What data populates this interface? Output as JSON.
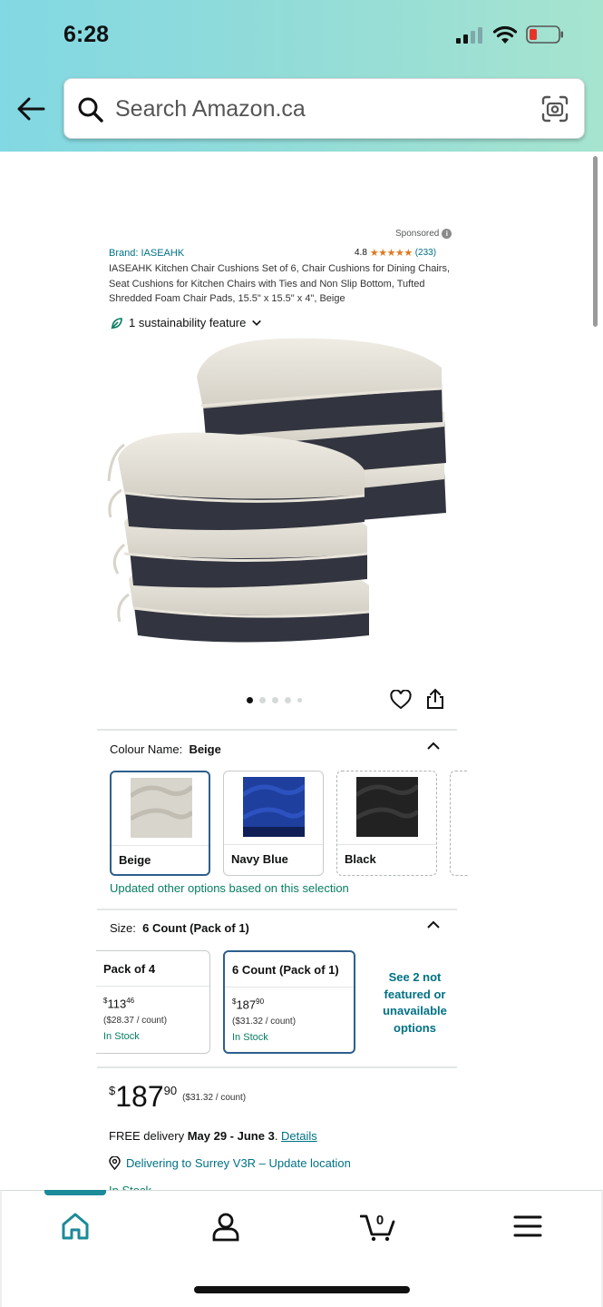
{
  "status_bar": {
    "time": "6:28"
  },
  "search": {
    "placeholder": "Search Amazon.ca"
  },
  "product": {
    "sponsored": "Sponsored",
    "brand": "Brand: IASEAHK",
    "rating_value": "4.8",
    "rating_stars": "★★★★★",
    "rating_count": "(233)",
    "title": "IASEAHK Kitchen Chair Cushions Set of 6, Chair Cushions for Dining Chairs, Seat Cushions for Kitchen Chairs with Ties and Non Slip Bottom, Tufted Shredded Foam Chair Pads, 15.5\" x 15.5\" x 4\", Beige",
    "sustainability": "1 sustainability feature",
    "image_dots": 5,
    "active_dot": 0
  },
  "colour": {
    "label": "Colour Name:",
    "selected": "Beige",
    "options": [
      {
        "name": "Beige",
        "color": "#d8d5cd"
      },
      {
        "name": "Navy Blue",
        "color": "#1f3f9e"
      },
      {
        "name": "Black",
        "color": "#222222"
      }
    ],
    "updated_note": "Updated other options based on this selection"
  },
  "size": {
    "label": "Size:",
    "selected": "6 Count (Pack of 1)",
    "options": [
      {
        "name": "Pack of 4",
        "currency": "$",
        "whole": "113",
        "fraction": "46",
        "per_count": "($28.37 / count)",
        "stock": "In Stock"
      },
      {
        "name": "6 Count (Pack of 1)",
        "currency": "$",
        "whole": "187",
        "fraction": "90",
        "per_count": "($31.32 / count)",
        "stock": "In Stock"
      }
    ],
    "see_more": "See 2 not featured or unavailable options"
  },
  "price": {
    "currency": "$",
    "whole": "187",
    "fraction": "90",
    "per_count": "($31.32 / count)"
  },
  "delivery": {
    "prefix": "FREE delivery ",
    "dates": "May 29 - June 3",
    "suffix": ". ",
    "details_link": "Details",
    "location": "Delivering to Surrey V3R – Update location",
    "stock": "In Stock"
  },
  "colors": {
    "teal_link": "#007185",
    "green": "#067D62",
    "accent": "#1b8a99",
    "selected_border": "#2d5f8d"
  },
  "bottom_nav": {
    "items": [
      "home-icon",
      "account-icon",
      "cart-icon",
      "menu-icon"
    ],
    "cart_count": "0"
  }
}
